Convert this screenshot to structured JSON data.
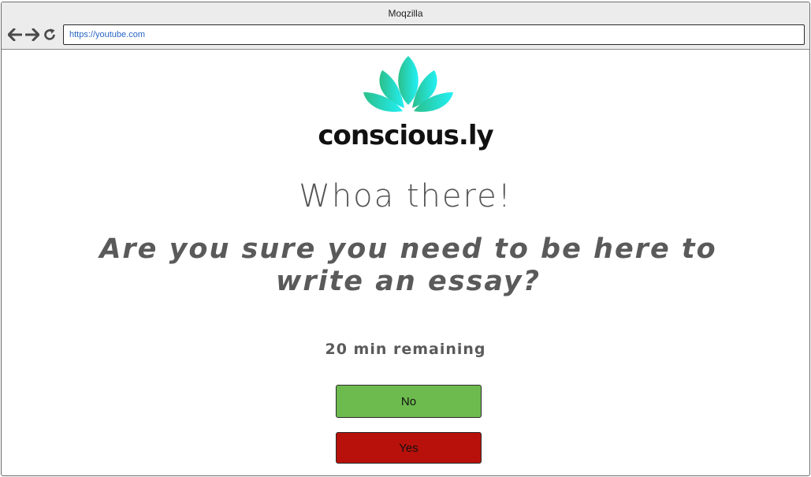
{
  "window": {
    "title": "Moqzilla"
  },
  "toolbar": {
    "url": "https://youtube.com",
    "icons": [
      "back-arrow-icon",
      "forward-arrow-icon",
      "reload-icon"
    ]
  },
  "brand": {
    "logo_icon": "lotus-icon",
    "name": "conscious.ly",
    "logo_gradient": [
      "#2bbf8a",
      "#22f0f5"
    ]
  },
  "main": {
    "headline": "Whoa there!",
    "question": "Are you sure you need to be here to write an essay?",
    "time_remaining": "20 min remaining"
  },
  "buttons": {
    "no_label": "No",
    "yes_label": "Yes",
    "no_color": "#6dbb4f",
    "yes_color": "#b8110c"
  }
}
